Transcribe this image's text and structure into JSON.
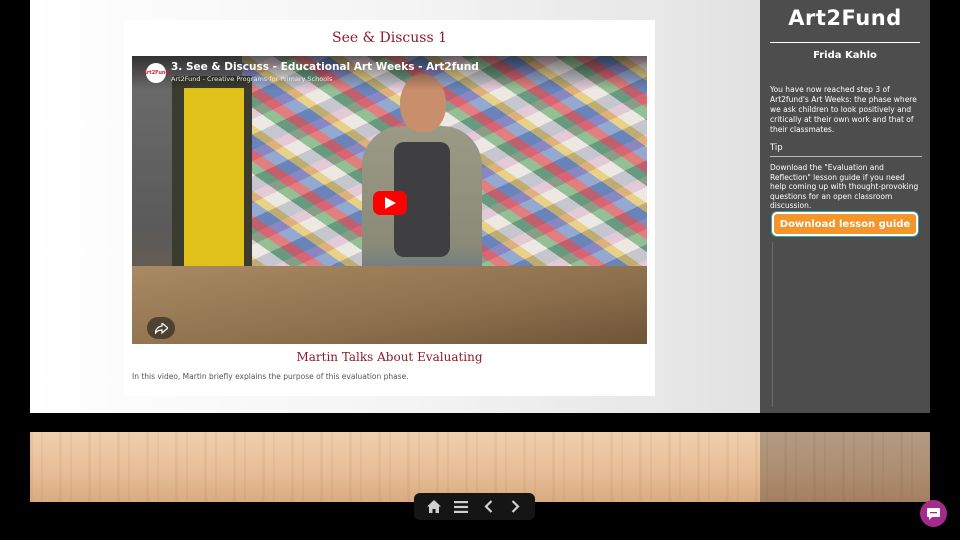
{
  "card": {
    "title": "See & Discuss 1",
    "caption": "Martin Talks About Evaluating",
    "description": "In this video, Martin briefly explains the purpose of this evaluation phase."
  },
  "video": {
    "title": "3. See & Discuss - Educational Art Weeks - Art2fund",
    "channel": "Art2Fund - Creative Programs for Primary Schools",
    "avatar_text": "Art2Fund",
    "play_icon": "youtube-play-icon",
    "share_icon": "share-icon"
  },
  "sidebar": {
    "logo": "Art2Fund",
    "subtitle": "Frida Kahlo",
    "intro": "You have now reached step 3 of Art2fund's Art Weeks: the phase where we ask children to look positively and critically at their own work and that of their classmates.",
    "tip_label": "Tip",
    "tip_text": "Download the \"Evaluation and Reflection\" lesson guide if you need help coming up with thought-provoking questions for an open classroom discussion.",
    "download_label": "Download lesson guide"
  },
  "nav": {
    "icons": [
      "home-icon",
      "menu-icon",
      "chevron-left-icon",
      "chevron-right-icon"
    ]
  },
  "chat": {
    "icon": "chat-icon"
  },
  "colors": {
    "accent_title": "#8c1c2a",
    "button_orange": "#f4952c",
    "sidebar_bg": "#4d4d4d",
    "chat_purple": "#a42a8c",
    "youtube_red": "#ff0000"
  }
}
